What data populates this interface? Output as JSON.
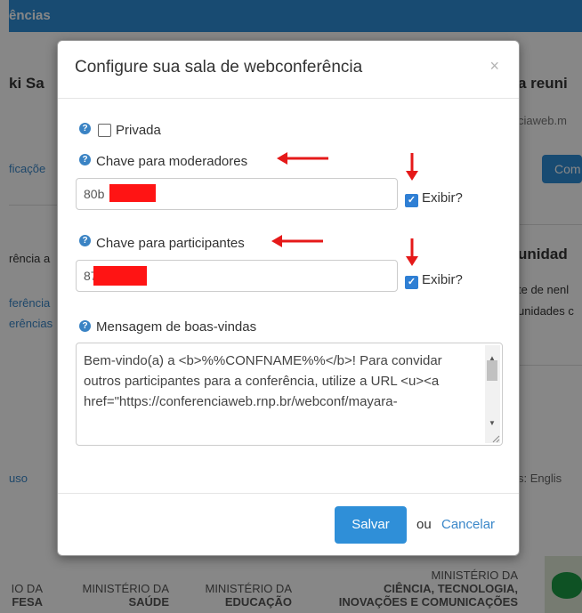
{
  "background": {
    "topbar_text": "ências",
    "side_title_left": "ki Sa",
    "side_title_right": "a reuni",
    "url_fragment": "ciaweb.m",
    "left_link1": "ficaçõe",
    "right_button": "Com",
    "left_text1": "rência a",
    "right_heading": "unidad",
    "right_text1": "te de nenl",
    "right_text2": "unidades c",
    "left_link2": "ferência",
    "left_link3": "erências",
    "footer_left": "uso",
    "footer_right": "s: Englis",
    "footer_logos": [
      {
        "line1": "IO DA",
        "line2": "FESA"
      },
      {
        "line1": "MINISTÉRIO DA",
        "line2": "SAÚDE"
      },
      {
        "line1": "MINISTÉRIO DA",
        "line2": "EDUCAÇÃO"
      },
      {
        "line1": "MINISTÉRIO DA",
        "line2": "CIÊNCIA, TECNOLOGIA,",
        "line3": "INOVAÇÕES E COMUNICAÇÕES"
      }
    ]
  },
  "modal": {
    "title": "Configure sua sala de webconferência",
    "close": "×",
    "help_glyph": "?",
    "private_label": "Privada",
    "private_checked": false,
    "moderator_label": "Chave para moderadores",
    "moderator_value": "80b",
    "participant_label": "Chave para participantes",
    "participant_value": "87",
    "show_label": "Exibir?",
    "show_moderator_checked": true,
    "show_participant_checked": true,
    "welcome_label": "Mensagem de boas-vindas",
    "welcome_text": "Bem-vindo(a) a <b>%%CONFNAME%%</b>! Para convidar outros participantes para a conferência, utilize a URL <u><a href=\"https://conferenciaweb.rnp.br/webconf/mayara-",
    "save_button": "Salvar",
    "or_text": "ou",
    "cancel_link": "Cancelar"
  },
  "colors": {
    "primary": "#2f8fd8",
    "annotation_red": "#e51919",
    "redaction_red": "#ff1414"
  }
}
